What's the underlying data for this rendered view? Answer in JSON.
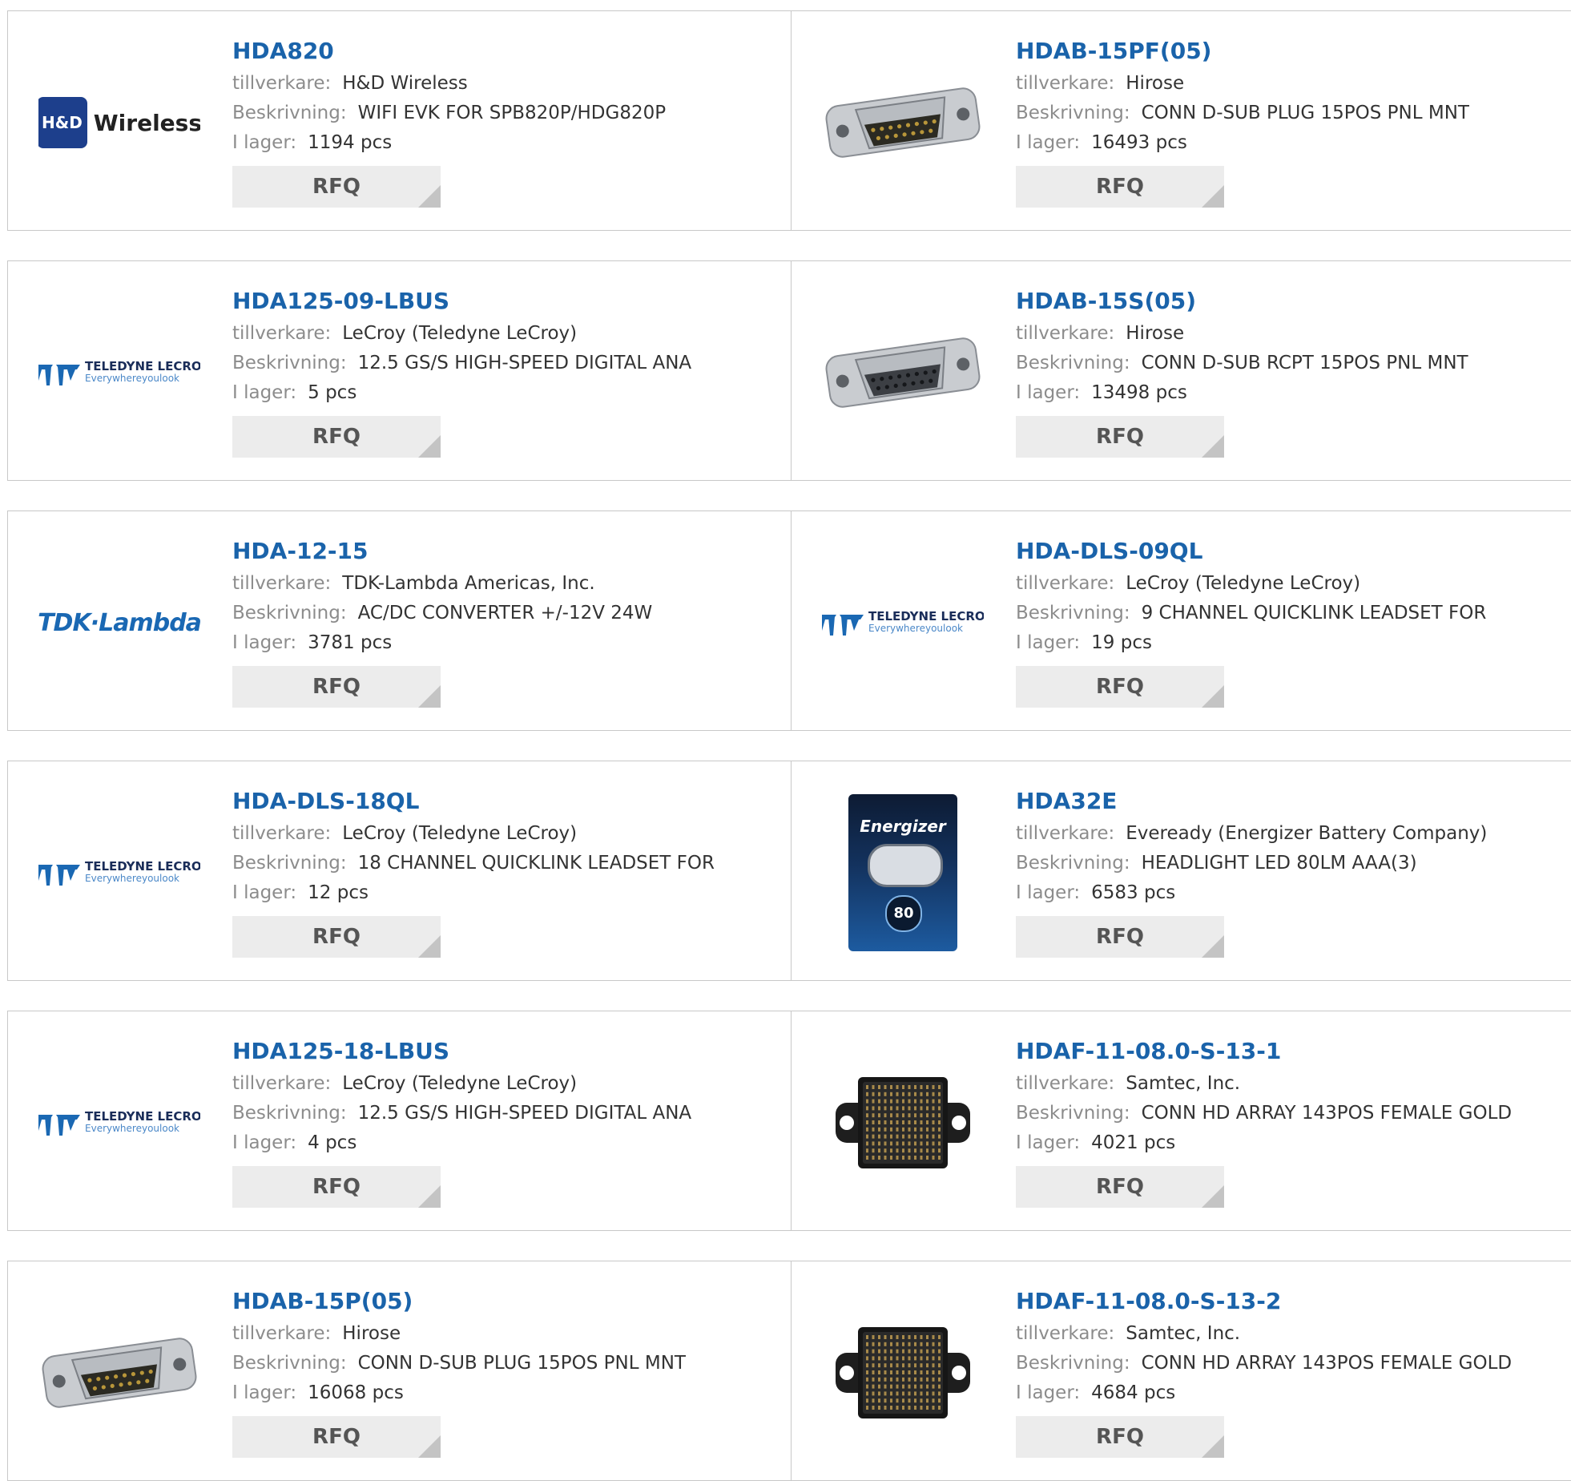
{
  "labels": {
    "manufacturer": "tillverkare:",
    "description": "Beskrivning:",
    "stock": "I lager:",
    "rfq": "RFQ"
  },
  "products": [
    {
      "part": "HDA820",
      "manufacturer": "H&D Wireless",
      "description": "WIFI EVK FOR SPB820P/HDG820P",
      "stock": "1194 pcs",
      "image": "hd-wireless-logo",
      "logo_text": [
        "H&D",
        "Wireless"
      ]
    },
    {
      "part": "HDAB-15PF(05)",
      "manufacturer": "Hirose",
      "description": "CONN D-SUB PLUG 15POS PNL MNT",
      "stock": "16493 pcs",
      "image": "dsub-plug-photo"
    },
    {
      "part": "HDA125-09-LBUS",
      "manufacturer": "LeCroy (Teledyne LeCroy)",
      "description": "12.5 GS/S HIGH-SPEED DIGITAL ANA",
      "stock": "5 pcs",
      "image": "teledyne-lecroy-logo",
      "logo_text": [
        "TELEDYNE LECROY",
        "Everywhereyoulook"
      ]
    },
    {
      "part": "HDAB-15S(05)",
      "manufacturer": "Hirose",
      "description": "CONN D-SUB RCPT 15POS PNL MNT",
      "stock": "13498 pcs",
      "image": "dsub-receptacle-photo"
    },
    {
      "part": "HDA-12-15",
      "manufacturer": "TDK-Lambda Americas, Inc.",
      "description": "AC/DC CONVERTER +/-12V 24W",
      "stock": "3781 pcs",
      "image": "tdk-lambda-logo",
      "logo_text": [
        "TDK·Lambda"
      ]
    },
    {
      "part": "HDA-DLS-09QL",
      "manufacturer": "LeCroy (Teledyne LeCroy)",
      "description": "9 CHANNEL QUICKLINK LEADSET FOR",
      "stock": "19 pcs",
      "image": "teledyne-lecroy-logo",
      "logo_text": [
        "TELEDYNE LECROY",
        "Everywhereyoulook"
      ]
    },
    {
      "part": "HDA-DLS-18QL",
      "manufacturer": "LeCroy (Teledyne LeCroy)",
      "description": "18 CHANNEL QUICKLINK LEADSET FOR",
      "stock": "12 pcs",
      "image": "teledyne-lecroy-logo",
      "logo_text": [
        "TELEDYNE LECROY",
        "Everywhereyoulook"
      ]
    },
    {
      "part": "HDA32E",
      "manufacturer": "Eveready (Energizer Battery Company)",
      "description": "HEADLIGHT LED 80LM AAA(3)",
      "stock": "6583 pcs",
      "image": "energizer-headlight-photo",
      "logo_text": [
        "Energizer",
        "80"
      ]
    },
    {
      "part": "HDA125-18-LBUS",
      "manufacturer": "LeCroy (Teledyne LeCroy)",
      "description": "12.5 GS/S HIGH-SPEED DIGITAL ANA",
      "stock": "4 pcs",
      "image": "teledyne-lecroy-logo",
      "logo_text": [
        "TELEDYNE LECROY",
        "Everywhereyoulook"
      ]
    },
    {
      "part": "HDAF-11-08.0-S-13-1",
      "manufacturer": "Samtec, Inc.",
      "description": "CONN HD ARRAY 143POS FEMALE GOLD",
      "stock": "4021 pcs",
      "image": "hd-array-connector-photo"
    },
    {
      "part": "HDAB-15P(05)",
      "manufacturer": "Hirose",
      "description": "CONN D-SUB PLUG 15POS PNL MNT",
      "stock": "16068 pcs",
      "image": "dsub-plug-photo"
    },
    {
      "part": "HDAF-11-08.0-S-13-2",
      "manufacturer": "Samtec, Inc.",
      "description": "CONN HD ARRAY 143POS FEMALE GOLD",
      "stock": "4684 pcs",
      "image": "hd-array-connector-photo"
    }
  ],
  "colors": {
    "link": "#1a63aa",
    "label": "#8c8c8c",
    "border": "#c8c8c8",
    "button_bg": "#ececec",
    "teledyne_blue": "#1a68b3",
    "hd_badge": "#1d3f8c"
  }
}
